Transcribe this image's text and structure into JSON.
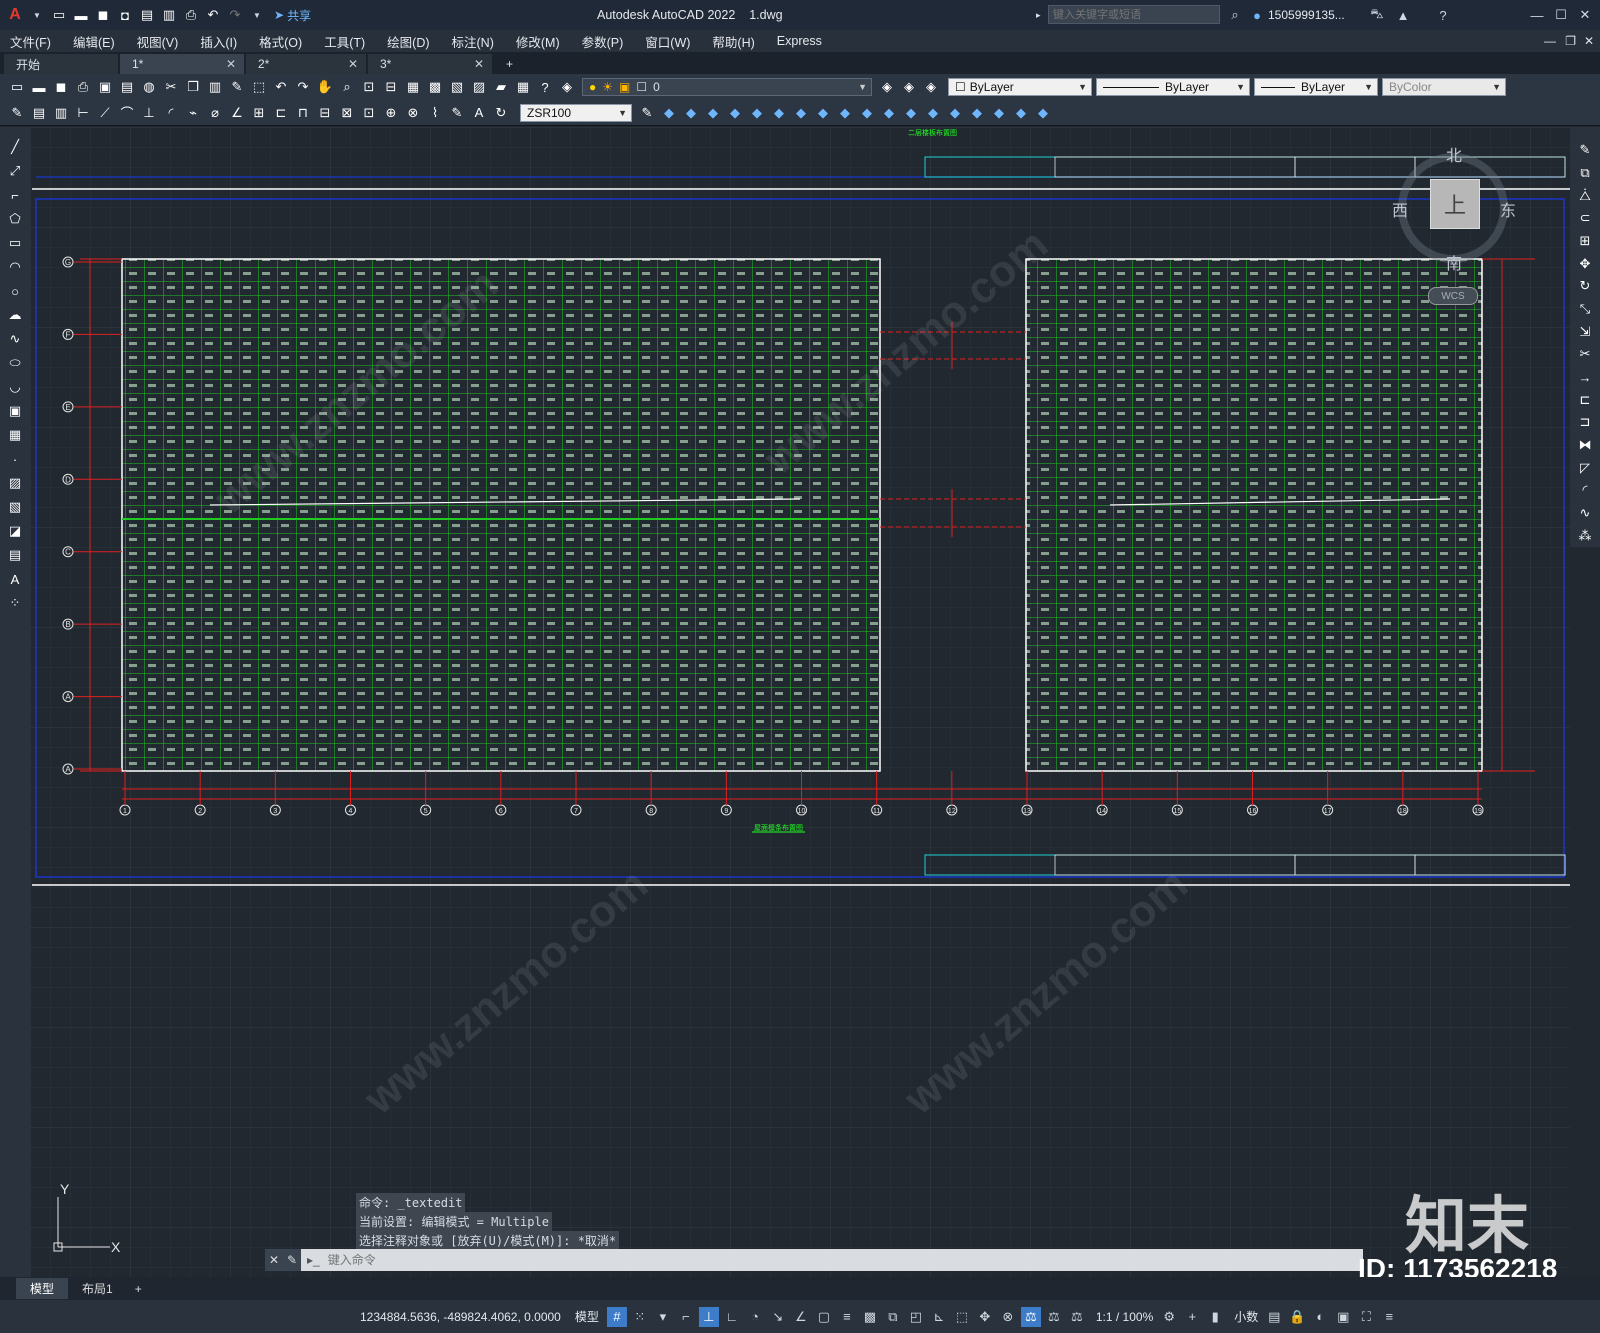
{
  "app": {
    "title": "Autodesk AutoCAD 2022",
    "filename": "1.dwg",
    "search_placeholder": "键入关键字或短语",
    "user": "1505999135..."
  },
  "quick_access": {
    "share_label": "共享"
  },
  "menu": [
    "文件(F)",
    "编辑(E)",
    "视图(V)",
    "插入(I)",
    "格式(O)",
    "工具(T)",
    "绘图(D)",
    "标注(N)",
    "修改(M)",
    "参数(P)",
    "窗口(W)",
    "帮助(H)",
    "Express"
  ],
  "tabs": [
    {
      "label": "开始"
    },
    {
      "label": "1*"
    },
    {
      "label": "2*"
    },
    {
      "label": "3*"
    }
  ],
  "properties": {
    "layer": "0",
    "color": "ByLayer",
    "linetype": "ByLayer",
    "lineweight": "ByLayer",
    "plotstyle": "ByColor",
    "dimstyle": "ZSR100"
  },
  "viewcube": {
    "north": "北",
    "south": "南",
    "east": "东",
    "west": "西",
    "face": "上",
    "wcs": "WCS"
  },
  "drawing": {
    "left_plan_title": "屋面檩条布置图",
    "top_plan_title": "二层楼板布置图",
    "grid_row_labels": [
      "G",
      "F",
      "E",
      "D",
      "C",
      "B",
      "A",
      "A"
    ],
    "grid_col_labels": [
      "1",
      "2",
      "3",
      "4",
      "5",
      "6",
      "7",
      "8",
      "9",
      "10",
      "11",
      "12",
      "13",
      "14",
      "15",
      "16",
      "17",
      "18",
      "19"
    ]
  },
  "command": {
    "history": [
      "命令: _textedit",
      "当前设置: 编辑模式 = Multiple",
      "选择注释对象或 [放弃(U)/模式(M)]: *取消*"
    ],
    "placeholder": "键入命令"
  },
  "ucs": {
    "x": "X",
    "y": "Y"
  },
  "layout_tabs": [
    "模型",
    "布局1"
  ],
  "status": {
    "coords": "1234884.5636, -489824.4062, 0.0000",
    "space": "模型",
    "scale": "1:1 / 100%",
    "units": "小数"
  },
  "watermark": {
    "brand": "知末",
    "id": "ID: 1173562218",
    "site": "www.znzmo.com"
  },
  "colors": {
    "accent": "#3d7cc9",
    "grid_green": "#22c922",
    "grid_red": "#e02020",
    "frame_blue": "#1a35c9"
  }
}
